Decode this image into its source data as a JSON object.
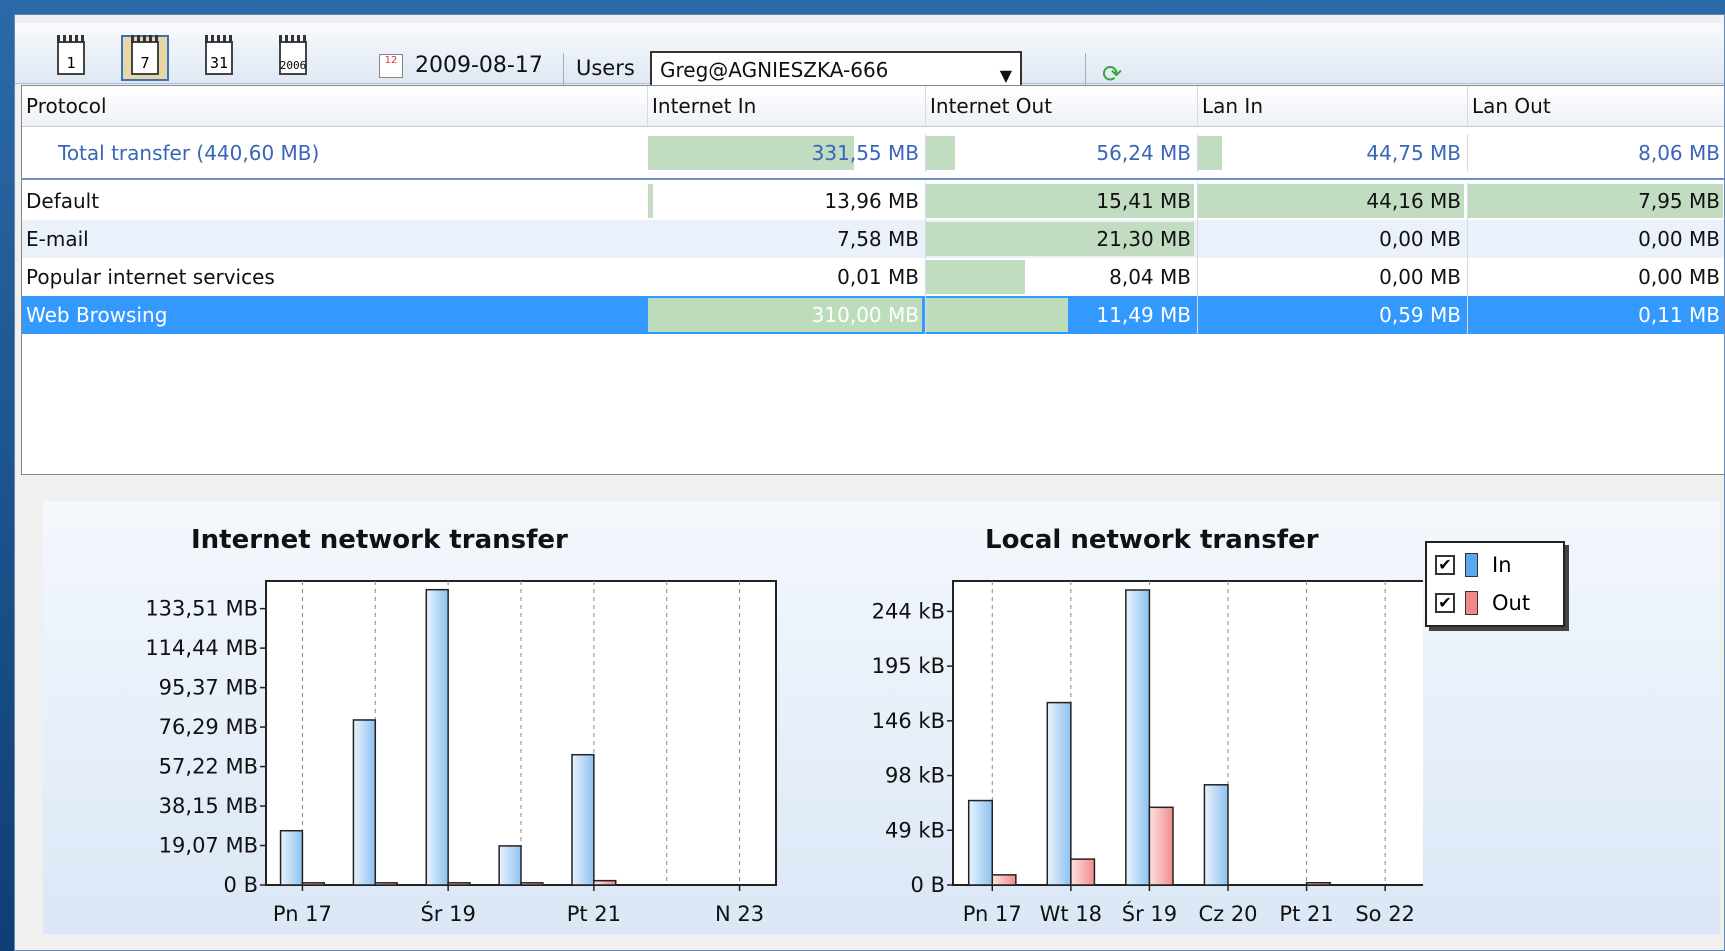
{
  "toolbar": {
    "day_btn": "1",
    "week_btn": "7",
    "month_btn": "31",
    "year_btn": "2006",
    "date_icon_day": "12",
    "date": "2009-08-17",
    "users_label": "Users",
    "user_selected": "Greg@AGNIESZKA-666",
    "icons": [
      "calendar-day-icon",
      "calendar-week-icon",
      "calendar-month-icon",
      "calendar-year-icon",
      "date-picker-icon",
      "dropdown-arrow-icon",
      "refresh-icon"
    ]
  },
  "table": {
    "columns": [
      "Protocol",
      "Internet In",
      "Internet Out",
      "Lan In",
      "Lan Out"
    ],
    "total": {
      "label": "Total transfer (440,60 MB)",
      "values": [
        "331,55 MB",
        "56,24 MB",
        "44,75 MB",
        "8,06 MB"
      ],
      "fill": [
        0.75,
        0.11,
        0.09,
        0.0
      ]
    },
    "rows": [
      {
        "label": "Default",
        "values": [
          "13,96 MB",
          "15,41 MB",
          "44,16 MB",
          "7,95 MB"
        ],
        "fill": [
          0.02,
          1.0,
          1.0,
          1.0
        ]
      },
      {
        "label": "E-mail",
        "values": [
          "7,58 MB",
          "21,30 MB",
          "0,00 MB",
          "0,00 MB"
        ],
        "fill": [
          0.0,
          1.0,
          0.0,
          0.0
        ]
      },
      {
        "label": "Popular internet services",
        "values": [
          "0,01 MB",
          "8,04 MB",
          "0,00 MB",
          "0,00 MB"
        ],
        "fill": [
          0.0,
          0.37,
          0.0,
          0.0
        ]
      },
      {
        "label": "Web Browsing",
        "values": [
          "310,00 MB",
          "11,49 MB",
          "0,59 MB",
          "0,11 MB"
        ],
        "fill": [
          1.0,
          0.53,
          0.0,
          0.0
        ],
        "selected": true
      }
    ],
    "bar_color": "#c1dcc1",
    "selected_color": "#3399ff"
  },
  "chart_data": [
    {
      "type": "bar",
      "title": "Internet network transfer",
      "categories": [
        "Pn 17",
        "Wt 18",
        "Śr 19",
        "Cz 20",
        "Pt 21",
        "So 22",
        "N 23"
      ],
      "tick_labels": [
        "Pn 17",
        "Śr 19",
        "Pt 21",
        "N 23"
      ],
      "y_ticks": [
        "0 B",
        "19,07 MB",
        "38,15 MB",
        "57,22 MB",
        "76,29 MB",
        "95,37 MB",
        "114,44 MB",
        "133,51 MB"
      ],
      "ylim": [
        0,
        140
      ],
      "series": [
        {
          "name": "In",
          "values": [
            25,
            76,
            136,
            18,
            60,
            0,
            0
          ],
          "color": "#9ccaf2"
        },
        {
          "name": "Out",
          "values": [
            1,
            1,
            1,
            1,
            2,
            0,
            0
          ],
          "color": "#f4a0a0"
        }
      ]
    },
    {
      "type": "bar",
      "title": "Local network transfer",
      "categories": [
        "Pn 17",
        "Wt 18",
        "Śr 19",
        "Cz 20",
        "Pt 21",
        "So 22",
        "N 23"
      ],
      "tick_labels": [
        "Pn 17",
        "Wt 18",
        "Śr 19",
        "Cz 20",
        "Pt 21",
        "So 22",
        "N 23"
      ],
      "y_ticks": [
        "0 B",
        "49 kB",
        "98 kB",
        "146 kB",
        "195 kB",
        "244 kB"
      ],
      "ylim": [
        0,
        270
      ],
      "series": [
        {
          "name": "In",
          "values": [
            75,
            162,
            262,
            89,
            0,
            0,
            0
          ],
          "color": "#9ccaf2"
        },
        {
          "name": "Out",
          "values": [
            9,
            23,
            69,
            0,
            2,
            0,
            0
          ],
          "color": "#f4a0a0"
        }
      ]
    }
  ],
  "legend": {
    "items": [
      {
        "label": "In",
        "color": "#5aa7ee",
        "checked": true
      },
      {
        "label": "Out",
        "color": "#f08a8a",
        "checked": true
      }
    ]
  }
}
